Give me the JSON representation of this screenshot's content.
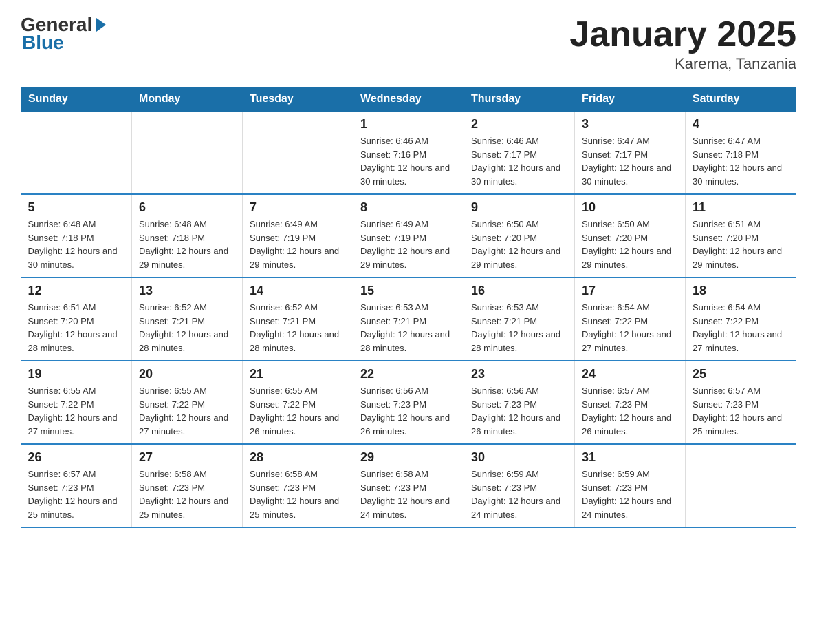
{
  "logo": {
    "general": "General",
    "blue": "Blue"
  },
  "header": {
    "title": "January 2025",
    "location": "Karema, Tanzania"
  },
  "days_of_week": [
    "Sunday",
    "Monday",
    "Tuesday",
    "Wednesday",
    "Thursday",
    "Friday",
    "Saturday"
  ],
  "weeks": [
    [
      {
        "day": "",
        "info": ""
      },
      {
        "day": "",
        "info": ""
      },
      {
        "day": "",
        "info": ""
      },
      {
        "day": "1",
        "info": "Sunrise: 6:46 AM\nSunset: 7:16 PM\nDaylight: 12 hours\nand 30 minutes."
      },
      {
        "day": "2",
        "info": "Sunrise: 6:46 AM\nSunset: 7:17 PM\nDaylight: 12 hours\nand 30 minutes."
      },
      {
        "day": "3",
        "info": "Sunrise: 6:47 AM\nSunset: 7:17 PM\nDaylight: 12 hours\nand 30 minutes."
      },
      {
        "day": "4",
        "info": "Sunrise: 6:47 AM\nSunset: 7:18 PM\nDaylight: 12 hours\nand 30 minutes."
      }
    ],
    [
      {
        "day": "5",
        "info": "Sunrise: 6:48 AM\nSunset: 7:18 PM\nDaylight: 12 hours\nand 30 minutes."
      },
      {
        "day": "6",
        "info": "Sunrise: 6:48 AM\nSunset: 7:18 PM\nDaylight: 12 hours\nand 29 minutes."
      },
      {
        "day": "7",
        "info": "Sunrise: 6:49 AM\nSunset: 7:19 PM\nDaylight: 12 hours\nand 29 minutes."
      },
      {
        "day": "8",
        "info": "Sunrise: 6:49 AM\nSunset: 7:19 PM\nDaylight: 12 hours\nand 29 minutes."
      },
      {
        "day": "9",
        "info": "Sunrise: 6:50 AM\nSunset: 7:20 PM\nDaylight: 12 hours\nand 29 minutes."
      },
      {
        "day": "10",
        "info": "Sunrise: 6:50 AM\nSunset: 7:20 PM\nDaylight: 12 hours\nand 29 minutes."
      },
      {
        "day": "11",
        "info": "Sunrise: 6:51 AM\nSunset: 7:20 PM\nDaylight: 12 hours\nand 29 minutes."
      }
    ],
    [
      {
        "day": "12",
        "info": "Sunrise: 6:51 AM\nSunset: 7:20 PM\nDaylight: 12 hours\nand 28 minutes."
      },
      {
        "day": "13",
        "info": "Sunrise: 6:52 AM\nSunset: 7:21 PM\nDaylight: 12 hours\nand 28 minutes."
      },
      {
        "day": "14",
        "info": "Sunrise: 6:52 AM\nSunset: 7:21 PM\nDaylight: 12 hours\nand 28 minutes."
      },
      {
        "day": "15",
        "info": "Sunrise: 6:53 AM\nSunset: 7:21 PM\nDaylight: 12 hours\nand 28 minutes."
      },
      {
        "day": "16",
        "info": "Sunrise: 6:53 AM\nSunset: 7:21 PM\nDaylight: 12 hours\nand 28 minutes."
      },
      {
        "day": "17",
        "info": "Sunrise: 6:54 AM\nSunset: 7:22 PM\nDaylight: 12 hours\nand 27 minutes."
      },
      {
        "day": "18",
        "info": "Sunrise: 6:54 AM\nSunset: 7:22 PM\nDaylight: 12 hours\nand 27 minutes."
      }
    ],
    [
      {
        "day": "19",
        "info": "Sunrise: 6:55 AM\nSunset: 7:22 PM\nDaylight: 12 hours\nand 27 minutes."
      },
      {
        "day": "20",
        "info": "Sunrise: 6:55 AM\nSunset: 7:22 PM\nDaylight: 12 hours\nand 27 minutes."
      },
      {
        "day": "21",
        "info": "Sunrise: 6:55 AM\nSunset: 7:22 PM\nDaylight: 12 hours\nand 26 minutes."
      },
      {
        "day": "22",
        "info": "Sunrise: 6:56 AM\nSunset: 7:23 PM\nDaylight: 12 hours\nand 26 minutes."
      },
      {
        "day": "23",
        "info": "Sunrise: 6:56 AM\nSunset: 7:23 PM\nDaylight: 12 hours\nand 26 minutes."
      },
      {
        "day": "24",
        "info": "Sunrise: 6:57 AM\nSunset: 7:23 PM\nDaylight: 12 hours\nand 26 minutes."
      },
      {
        "day": "25",
        "info": "Sunrise: 6:57 AM\nSunset: 7:23 PM\nDaylight: 12 hours\nand 25 minutes."
      }
    ],
    [
      {
        "day": "26",
        "info": "Sunrise: 6:57 AM\nSunset: 7:23 PM\nDaylight: 12 hours\nand 25 minutes."
      },
      {
        "day": "27",
        "info": "Sunrise: 6:58 AM\nSunset: 7:23 PM\nDaylight: 12 hours\nand 25 minutes."
      },
      {
        "day": "28",
        "info": "Sunrise: 6:58 AM\nSunset: 7:23 PM\nDaylight: 12 hours\nand 25 minutes."
      },
      {
        "day": "29",
        "info": "Sunrise: 6:58 AM\nSunset: 7:23 PM\nDaylight: 12 hours\nand 24 minutes."
      },
      {
        "day": "30",
        "info": "Sunrise: 6:59 AM\nSunset: 7:23 PM\nDaylight: 12 hours\nand 24 minutes."
      },
      {
        "day": "31",
        "info": "Sunrise: 6:59 AM\nSunset: 7:23 PM\nDaylight: 12 hours\nand 24 minutes."
      },
      {
        "day": "",
        "info": ""
      }
    ]
  ]
}
